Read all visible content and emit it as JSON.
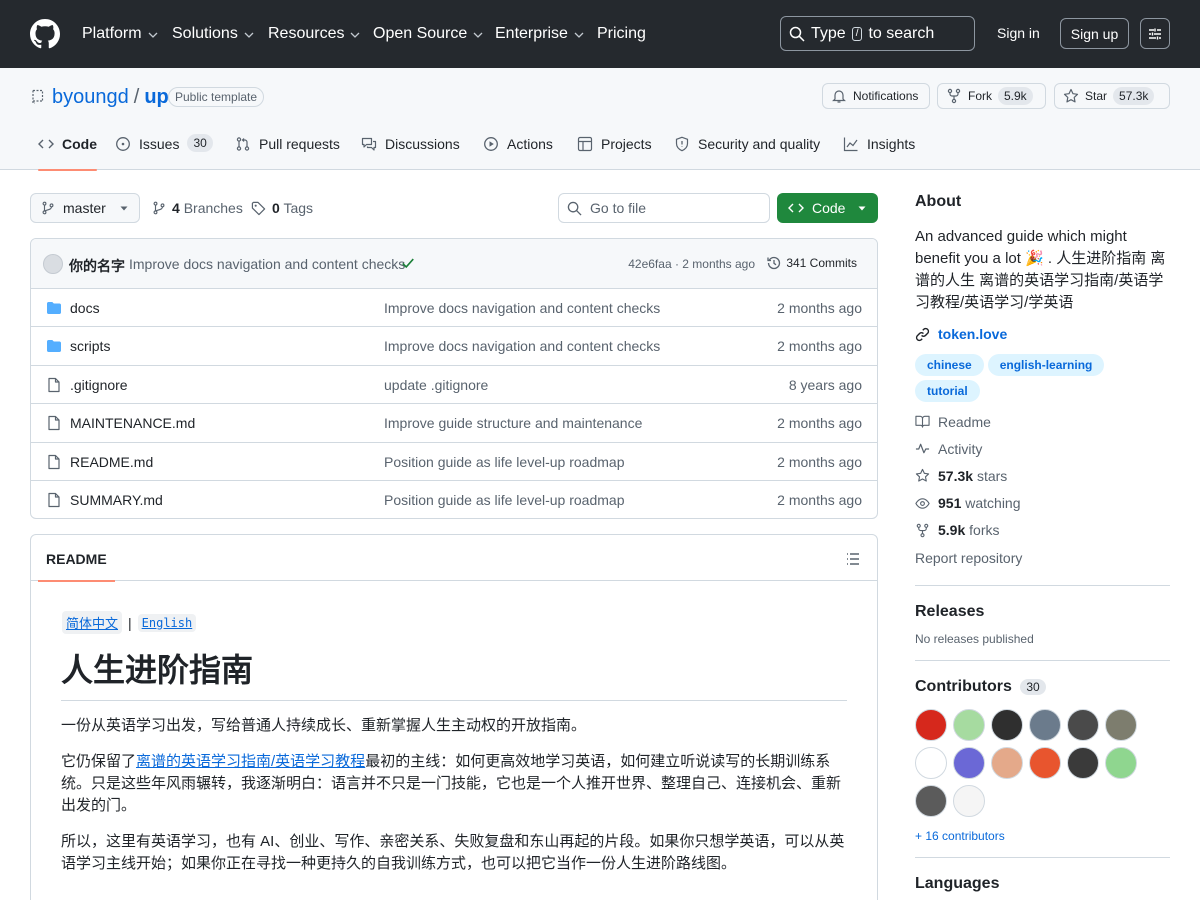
{
  "nav": {
    "items": [
      "Platform",
      "Solutions",
      "Resources",
      "Open Source",
      "Enterprise",
      "Pricing"
    ],
    "search_prefix": "Type",
    "search_key": "/",
    "search_suffix": "to search",
    "sign_in": "Sign in",
    "sign_up": "Sign up"
  },
  "repo": {
    "owner": "byoungd",
    "separator": "/",
    "name": "up",
    "visibility": "Public template",
    "notifications": "Notifications",
    "fork_label": "Fork",
    "fork_count": "5.9k",
    "star_label": "Star",
    "star_count": "57.3k"
  },
  "tabs": [
    {
      "label": "Code"
    },
    {
      "label": "Issues",
      "count": "30"
    },
    {
      "label": "Pull requests"
    },
    {
      "label": "Discussions"
    },
    {
      "label": "Actions"
    },
    {
      "label": "Projects"
    },
    {
      "label": "Security and quality"
    },
    {
      "label": "Insights"
    }
  ],
  "toolbar": {
    "branch": "master",
    "branches_count": "4",
    "branches_label": "Branches",
    "tags_count": "0",
    "tags_label": "Tags",
    "goto_placeholder": "Go to file",
    "code_button": "Code"
  },
  "commit": {
    "author": "你的名字",
    "message": "Improve docs navigation and content checks",
    "hash_age": "42e6faa · 2 months ago",
    "count": "341 Commits"
  },
  "files": [
    {
      "name": "docs",
      "type": "folder",
      "message": "Improve docs navigation and content checks",
      "age": "2 months ago"
    },
    {
      "name": "scripts",
      "type": "folder",
      "message": "Improve docs navigation and content checks",
      "age": "2 months ago"
    },
    {
      "name": ".gitignore",
      "type": "file",
      "message": "update .gitignore",
      "age": "8 years ago"
    },
    {
      "name": "MAINTENANCE.md",
      "type": "file",
      "message": "Improve guide structure and maintenance",
      "age": "2 months ago"
    },
    {
      "name": "README.md",
      "type": "file",
      "message": "Position guide as life level-up roadmap",
      "age": "2 months ago"
    },
    {
      "name": "SUMMARY.md",
      "type": "file",
      "message": "Position guide as life level-up roadmap",
      "age": "2 months ago"
    }
  ],
  "readme": {
    "tab": "README",
    "lang_zh": "简体中文",
    "lang_sep": "|",
    "lang_en": "English",
    "title": "人生进阶指南",
    "p1": "一份从英语学习出发，写给普通人持续成长、重新掌握人生主动权的开放指南。",
    "p2_pre": "它仍保留了",
    "p2_link": "离谱的英语学习指南/英语学习教程",
    "p2_post": "最初的主线：如何更高效地学习英语，如何建立听说读写的长期训练系统。只是这些年风雨辗转，我逐渐明白：语言并不只是一门技能，它也是一个人推开世界、整理自己、连接机会、重新出发的门。",
    "p3": "所以，这里有英语学习，也有 AI、创业、写作、亲密关系、失败复盘和东山再起的片段。如果你只想学英语，可以从英语学习主线开始；如果你正在寻找一种更持久的自我训练方式，也可以把它当作一份人生进阶路线图。"
  },
  "about": {
    "heading": "About",
    "description": "An advanced guide which might benefit you a lot 🎉 . 人生进阶指南 离谱的人生 离谱的英语学习指南/英语学习教程/英语学习/学英语",
    "website": "token.love",
    "topics": [
      "chinese",
      "english-learning",
      "tutorial"
    ],
    "readme": "Readme",
    "activity": "Activity",
    "stars_count": "57.3k",
    "stars_label": "stars",
    "watching_count": "951",
    "watching_label": "watching",
    "forks_count": "5.9k",
    "forks_label": "forks",
    "report": "Report repository"
  },
  "releases": {
    "heading": "Releases",
    "text": "No releases published"
  },
  "contributors": {
    "heading": "Contributors",
    "count": "30",
    "more": "+ 16 contributors",
    "avatar_colors": [
      "#d6281c",
      "#a6dba0",
      "#2f2f2f",
      "#6b7b8c",
      "#4a4a4a",
      "#7d7d6e",
      "#ffffff",
      "#6b68d6",
      "#e4a98a",
      "#e8552e",
      "#3a3a3a",
      "#8fd68f",
      "#5b5b5b",
      "#f5f5f5"
    ]
  },
  "languages": {
    "heading": "Languages",
    "bar_color": "#f1e05a"
  }
}
